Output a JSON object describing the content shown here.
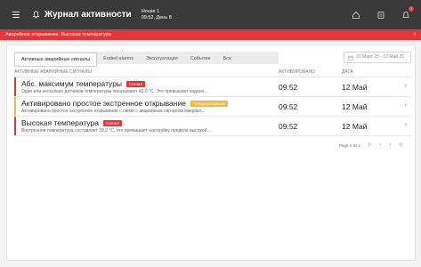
{
  "header": {
    "title": "Журнал активности",
    "house": "House 1",
    "time_day": "09:52, День 8"
  },
  "alert_banner": {
    "text": "Аварийное открывание. Высокая температура"
  },
  "tabs": [
    {
      "label": "Активные аварийные сигналы"
    },
    {
      "label": "Ended alarms"
    },
    {
      "label": "Эксплуатация"
    },
    {
      "label": "Событие"
    },
    {
      "label": "Все"
    }
  ],
  "date_range": "31 Март 25 - 12 Май 25",
  "table": {
    "columns": [
      "АКТИВНЫЕ АВАРИЙНЫЕ СИГНАЛЫ",
      "АКТИВИРОВАНО",
      "ДАТА"
    ],
    "rows": [
      {
        "name": "Абс. максимум температуры",
        "tag": "Сигнал",
        "tag_color": "#e1363a",
        "bar_color": "#e1363a",
        "description": "Один или несколько датчиков температуры показывают 42,0 °C. Это превышает заданн...",
        "activated": "09:52",
        "date": "12 Май"
      },
      {
        "name": "Активировано простое экстренное открывание",
        "tag": "Предупреждение",
        "tag_color": "#f2b63a",
        "bar_color": "#f2b63a",
        "description": "Активировано простое экстренное открывание с связи с аварийным сигналом микрокл...",
        "activated": "09:52",
        "date": "12 Май"
      },
      {
        "name": "Высокая температура",
        "tag": "Сигнал",
        "tag_color": "#e1363a",
        "bar_color": "#e1363a",
        "description": "Внутренняя температура составляет 39,2 °C, что превышает настройку предела высокой...",
        "activated": "09:52",
        "date": "12 Май"
      }
    ]
  },
  "pagination": {
    "text": "Page 1 из 1"
  },
  "icons": {
    "menu": "menu-icon",
    "bell": "bell-icon",
    "home": "home-icon",
    "document": "document-icon",
    "notification": "notification-icon",
    "calendar": "calendar-icon"
  },
  "notification_count": "2"
}
